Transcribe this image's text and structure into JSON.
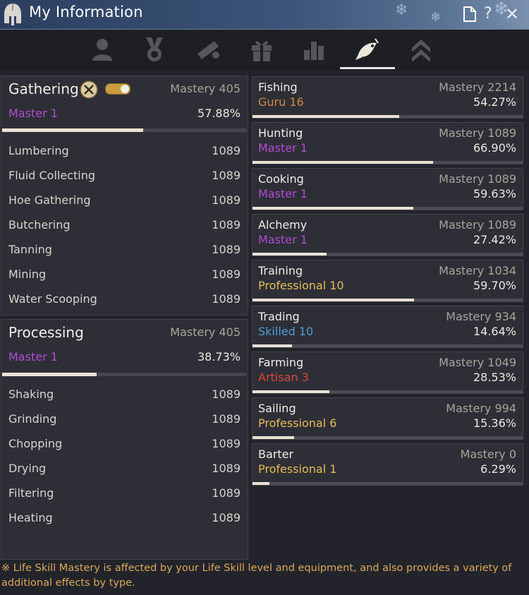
{
  "window": {
    "title": "My Information"
  },
  "tabs": [
    {
      "icon": "character-icon"
    },
    {
      "icon": "medal-icon"
    },
    {
      "icon": "telescope-scroll-icon"
    },
    {
      "icon": "gift-icon"
    },
    {
      "icon": "bar-chart-icon"
    },
    {
      "icon": "life-skill-fish-icon",
      "active": true
    },
    {
      "icon": "rank-chevron-icon"
    }
  ],
  "gathering": {
    "title": "Gathering",
    "mastery": "Mastery 405",
    "rank": "Master 1",
    "percent": "57.88%",
    "progress": 0.5788,
    "rank_color": "#b24ad6",
    "items": [
      {
        "name": "Lumbering",
        "value": "1089"
      },
      {
        "name": "Fluid Collecting",
        "value": "1089"
      },
      {
        "name": "Hoe Gathering",
        "value": "1089"
      },
      {
        "name": "Butchering",
        "value": "1089"
      },
      {
        "name": "Tanning",
        "value": "1089"
      },
      {
        "name": "Mining",
        "value": "1089"
      },
      {
        "name": "Water Scooping",
        "value": "1089"
      }
    ]
  },
  "processing": {
    "title": "Processing",
    "mastery": "Mastery 405",
    "rank": "Master 1",
    "percent": "38.73%",
    "progress": 0.3873,
    "rank_color": "#b24ad6",
    "items": [
      {
        "name": "Shaking",
        "value": "1089"
      },
      {
        "name": "Grinding",
        "value": "1089"
      },
      {
        "name": "Chopping",
        "value": "1089"
      },
      {
        "name": "Drying",
        "value": "1089"
      },
      {
        "name": "Filtering",
        "value": "1089"
      },
      {
        "name": "Heating",
        "value": "1089"
      }
    ]
  },
  "skills": [
    {
      "name": "Fishing",
      "mastery": "Mastery 2214",
      "rank": "Guru 16",
      "percent": "54.27%",
      "progress": 0.5427,
      "rank_color": "#d3893c"
    },
    {
      "name": "Hunting",
      "mastery": "Mastery 1089",
      "rank": "Master 1",
      "percent": "66.90%",
      "progress": 0.669,
      "rank_color": "#b24ad6"
    },
    {
      "name": "Cooking",
      "mastery": "Mastery 1089",
      "rank": "Master 1",
      "percent": "59.63%",
      "progress": 0.5963,
      "rank_color": "#b24ad6"
    },
    {
      "name": "Alchemy",
      "mastery": "Mastery 1089",
      "rank": "Master 1",
      "percent": "27.42%",
      "progress": 0.2742,
      "rank_color": "#b24ad6"
    },
    {
      "name": "Training",
      "mastery": "Mastery 1034",
      "rank": "Professional 10",
      "percent": "59.70%",
      "progress": 0.597,
      "rank_color": "#e3bc5a"
    },
    {
      "name": "Trading",
      "mastery": "Mastery 934",
      "rank": "Skilled 10",
      "percent": "14.64%",
      "progress": 0.1464,
      "rank_color": "#4d9ad8"
    },
    {
      "name": "Farming",
      "mastery": "Mastery 1049",
      "rank": "Artisan 3",
      "percent": "28.53%",
      "progress": 0.2853,
      "rank_color": "#d8453c"
    },
    {
      "name": "Sailing",
      "mastery": "Mastery 994",
      "rank": "Professional 6",
      "percent": "15.36%",
      "progress": 0.1536,
      "rank_color": "#e3bc5a"
    },
    {
      "name": "Barter",
      "mastery": "Mastery 0",
      "rank": "Professional 1",
      "percent": "6.29%",
      "progress": 0.0629,
      "rank_color": "#e3bc5a"
    }
  ],
  "footer": {
    "note": "※ Life Skill Mastery is affected by your Life Skill level and equipment, and also provides a variety of additional effects by type."
  },
  "colors": {
    "accent_gold": "#d8a85a",
    "master_purple": "#b24ad6"
  }
}
